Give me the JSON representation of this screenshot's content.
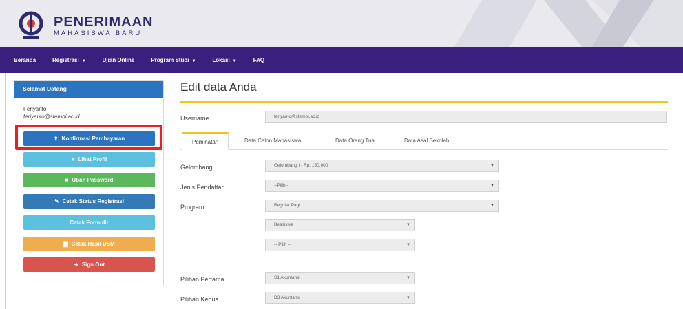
{
  "brand": {
    "title": "PENERIMAAN",
    "subtitle": "MAHASISWA BARU"
  },
  "nav": [
    {
      "label": "Beranda",
      "dropdown": false
    },
    {
      "label": "Registrasi",
      "dropdown": true
    },
    {
      "label": "Ujian Online",
      "dropdown": false
    },
    {
      "label": "Program Studi",
      "dropdown": true
    },
    {
      "label": "Lokasi",
      "dropdown": true
    },
    {
      "label": "FAQ",
      "dropdown": false
    }
  ],
  "sidebar": {
    "heading": "Selamat Datang",
    "user_name": "Feriyanto",
    "user_email": "feriyanto@stembi.ac.id",
    "buttons": [
      {
        "label": "Konfirmasi Pembayaran",
        "icon": "upload-icon",
        "glyph": "⬆",
        "color": "#2c74c0",
        "highlighted": true
      },
      {
        "label": "Lihat Profil",
        "icon": "user-icon",
        "glyph": "👤",
        "color": "#5bc0de"
      },
      {
        "label": "Ubah Password",
        "icon": "lock-icon",
        "glyph": "🔒",
        "color": "#5cb85c"
      },
      {
        "label": "Cetak Status Registrasi",
        "icon": "edit-icon",
        "glyph": "✎",
        "color": "#337ab7"
      },
      {
        "label": "Cetak Formulir",
        "icon": "",
        "glyph": "",
        "color": "#5bc0de"
      },
      {
        "label": "Cetak Hasil USM",
        "icon": "file-icon",
        "glyph": "▇",
        "color": "#f0ad4e"
      },
      {
        "label": "Sign Out",
        "icon": "sign-out-icon",
        "glyph": "➜",
        "color": "#d9534f"
      }
    ],
    "highlight_color": "#ee1c24"
  },
  "main": {
    "title": "Edit data Anda",
    "username_label": "Username",
    "username_value": "feriyanto@stembi.ac.id",
    "tabs": [
      "Peminatan",
      "Data Calon Mahasiswa",
      "Data Orang Tua",
      "Data Asal Sekolah"
    ],
    "fields": {
      "gelombang": {
        "label": "Gelombang",
        "value": "Gelombang I - Rp. 150.000"
      },
      "jenis": {
        "label": "Jenis Pendaftar",
        "value": "--Pilih--"
      },
      "program": {
        "label": "Program",
        "value": "Reguler Pagi"
      },
      "beasiswa": {
        "value": "Beasiswa"
      },
      "pilih": {
        "value": "-- Pilih --"
      },
      "pilihan1": {
        "label": "Pilihan Pertama",
        "value": "S1 Akuntansi"
      },
      "pilihan2": {
        "label": "Pilihan Kedua",
        "value": "D3 Akuntansi"
      }
    }
  },
  "colors": {
    "navbar": "#3b1f7e",
    "accent": "#f0c419",
    "brand": "#2d2a6e"
  }
}
